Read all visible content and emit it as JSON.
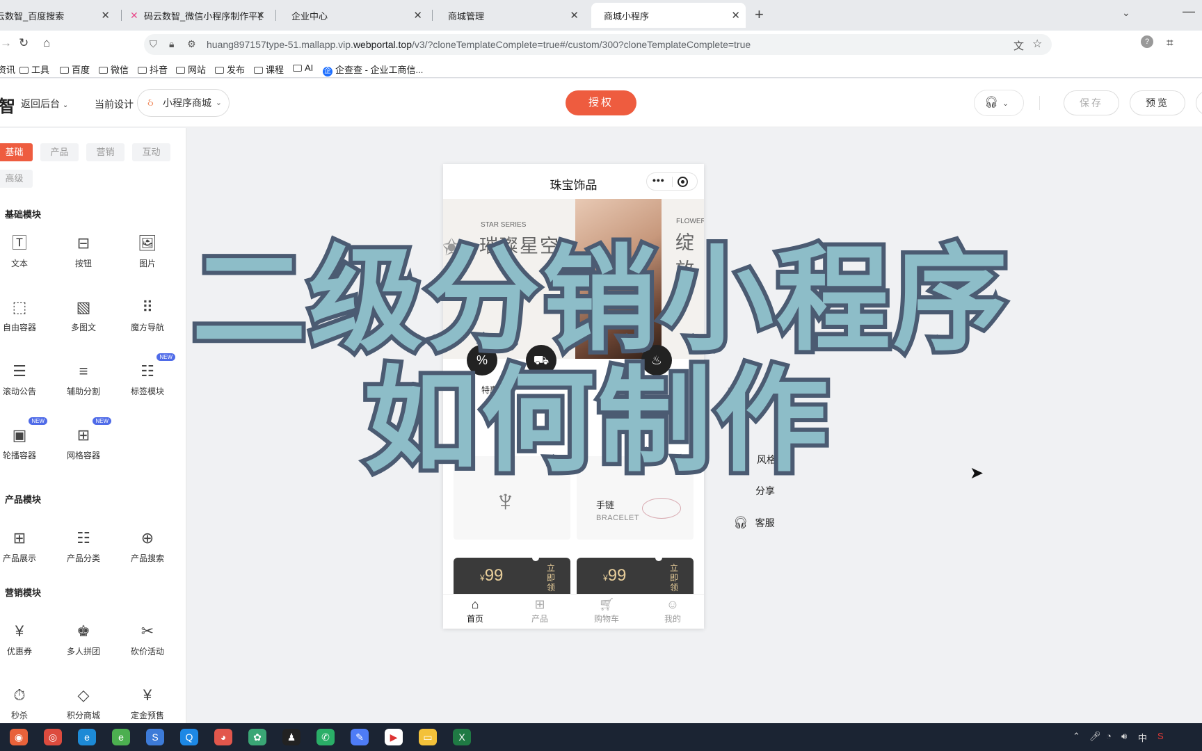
{
  "browser": {
    "tabs": [
      {
        "title": "云数智_百度搜索",
        "active": false
      },
      {
        "title": "码云数智_微信小程序制作平台",
        "active": false
      },
      {
        "title": "企业中心",
        "active": false
      },
      {
        "title": "商城管理",
        "active": false
      },
      {
        "title": "商城小程序",
        "active": true
      }
    ],
    "url": {
      "pre": "huang897157type-51.mallapp.vip.",
      "host": "webportal.top",
      "post": "/v3/?cloneTemplateComplete=true#/custom/300?cloneTemplateComplete=true"
    },
    "bookmarks": [
      "资讯",
      "工具",
      "百度",
      "微信",
      "抖音",
      "网站",
      "发布",
      "课程",
      "AI",
      "企查查 - 企业工商信..."
    ]
  },
  "header": {
    "logo_fragment": "智",
    "back_label": "返回后台",
    "current_design_label": "当前设计",
    "current_design_value": "小程序商城",
    "authorize_label": "授权",
    "save_label": "保存",
    "preview_label": "预览"
  },
  "sidebar": {
    "tabs": [
      "基础",
      "产品",
      "营销",
      "互动",
      "高级"
    ],
    "sections": [
      {
        "title": "基础模块",
        "items": [
          {
            "label": "文本",
            "icon": "text-box-icon",
            "glyph": "🅃",
            "new": false
          },
          {
            "label": "按钮",
            "icon": "button-icon",
            "glyph": "⊟",
            "new": false
          },
          {
            "label": "图片",
            "icon": "image-icon",
            "glyph": "🖼",
            "new": false
          },
          {
            "label": "自由容器",
            "icon": "free-container-icon",
            "glyph": "⬚",
            "new": false
          },
          {
            "label": "多图文",
            "icon": "multi-image-icon",
            "glyph": "▧",
            "new": false
          },
          {
            "label": "魔方导航",
            "icon": "grid-dots-icon",
            "glyph": "⠿",
            "new": false
          },
          {
            "label": "滚动公告",
            "icon": "notice-icon",
            "glyph": "☰",
            "new": false
          },
          {
            "label": "辅助分割",
            "icon": "divider-icon",
            "glyph": "≡",
            "new": false
          },
          {
            "label": "标签模块",
            "icon": "tag-list-icon",
            "glyph": "☷",
            "new": true
          },
          {
            "label": "轮播容器",
            "icon": "carousel-icon",
            "glyph": "▣",
            "new": true
          },
          {
            "label": "网格容器",
            "icon": "grid-container-icon",
            "glyph": "⊞",
            "new": true
          }
        ]
      },
      {
        "title": "产品模块",
        "items": [
          {
            "label": "产品展示",
            "icon": "product-grid-icon",
            "glyph": "⊞",
            "new": false
          },
          {
            "label": "产品分类",
            "icon": "product-category-icon",
            "glyph": "☷",
            "new": false
          },
          {
            "label": "产品搜索",
            "icon": "product-search-icon",
            "glyph": "⊕",
            "new": false
          }
        ]
      },
      {
        "title": "营销模块",
        "items": [
          {
            "label": "优惠券",
            "icon": "coupon-icon",
            "glyph": "¥",
            "new": false
          },
          {
            "label": "多人拼团",
            "icon": "group-buy-icon",
            "glyph": "♚",
            "new": false
          },
          {
            "label": "砍价活动",
            "icon": "bargain-icon",
            "glyph": "✂",
            "new": false
          },
          {
            "label": "秒杀",
            "icon": "flash-sale-icon",
            "glyph": "⏱",
            "new": false
          },
          {
            "label": "积分商城",
            "icon": "points-mall-icon",
            "glyph": "◇",
            "new": false
          },
          {
            "label": "定金预售",
            "icon": "presale-icon",
            "glyph": "¥",
            "new": false
          }
        ]
      }
    ],
    "new_badge": "NEW"
  },
  "phone": {
    "title": "珠宝饰品",
    "banner": {
      "left_en": "STAR SERIES",
      "left_cn": "璀璨星空",
      "right_en": "FLOWER",
      "right_cn": "绽放"
    },
    "nav_labels": [
      "特惠"
    ],
    "product_card": {
      "title": "手链",
      "subtitle": "BRACELET"
    },
    "coupons": [
      {
        "price": "99",
        "currency": "¥",
        "action": "立即领"
      },
      {
        "price": "99",
        "currency": "¥",
        "action": "立即领"
      }
    ],
    "tabbar": [
      {
        "label": "首页",
        "active": true
      },
      {
        "label": "产品",
        "active": false
      },
      {
        "label": "购物车",
        "active": false
      },
      {
        "label": "我的",
        "active": false
      }
    ]
  },
  "float_menu": {
    "style_label": "风格",
    "share_label": "分享",
    "service_label": "客服"
  },
  "overlay": {
    "line1": "二级分销小程序",
    "line2": "如何制作"
  },
  "colors": {
    "accent": "#ee5c3f",
    "overlay_fill": "#8dbdc8",
    "overlay_stroke": "#4b5b72",
    "coupon_bg": "#3a3a3a",
    "coupon_text": "#e9cf9b",
    "badge_new": "#4f6be8"
  }
}
